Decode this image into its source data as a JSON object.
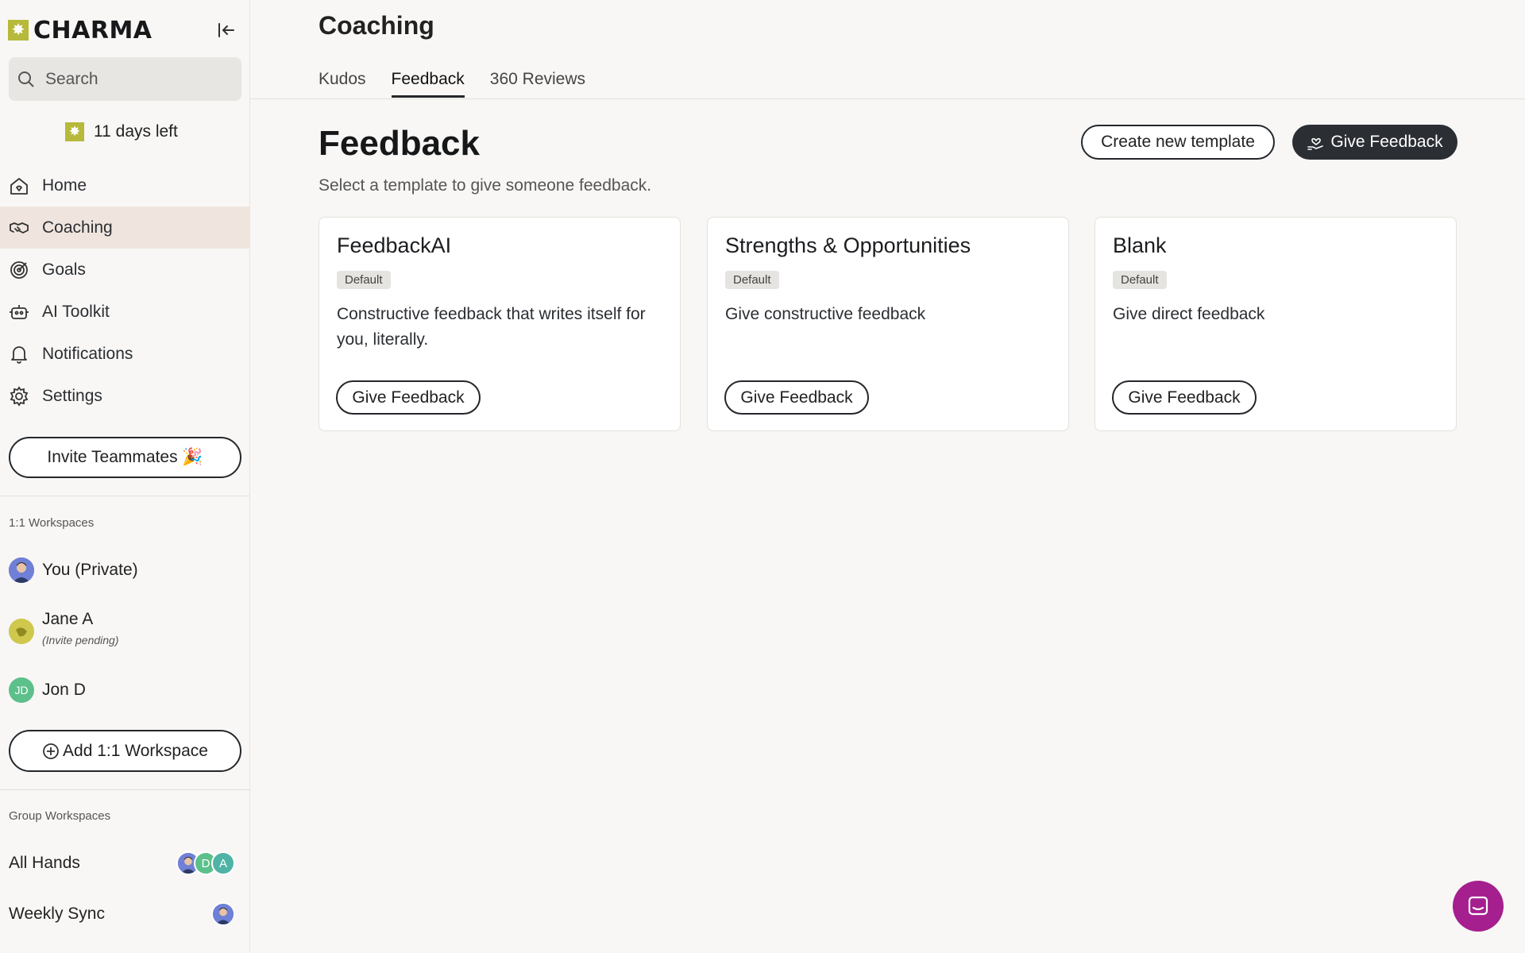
{
  "brand": {
    "name": "CHARMA",
    "logo_glyph": "✸"
  },
  "search": {
    "placeholder": "Search"
  },
  "trial": {
    "text": "11 days left",
    "glyph": "✸"
  },
  "nav": {
    "home": "Home",
    "coaching": "Coaching",
    "goals": "Goals",
    "ai_toolkit": "AI Toolkit",
    "notifications": "Notifications",
    "settings": "Settings"
  },
  "invite": {
    "label": "Invite Teammates 🎉"
  },
  "workspaces": {
    "label": "1:1 Workspaces",
    "you": "You (Private)",
    "jane": {
      "name": "Jane A",
      "status": "(Invite pending)"
    },
    "jon": {
      "name": "Jon D",
      "initials": "JD"
    },
    "add_label": "Add 1:1 Workspace"
  },
  "groups": {
    "label": "Group Workspaces",
    "all_hands": {
      "name": "All Hands",
      "initials": [
        "D",
        "A"
      ]
    },
    "weekly_sync": {
      "name": "Weekly Sync"
    }
  },
  "header": {
    "title": "Coaching",
    "tabs": [
      "Kudos",
      "Feedback",
      "360 Reviews"
    ]
  },
  "feedback": {
    "title": "Feedback",
    "subtitle": "Select a template to give someone feedback.",
    "create_template": "Create new template",
    "give_feedback": "Give Feedback",
    "cards": [
      {
        "title": "FeedbackAI",
        "badge": "Default",
        "desc": "Constructive feedback that writes itself for you, literally.",
        "button": "Give Feedback"
      },
      {
        "title": "Strengths & Opportunities",
        "badge": "Default",
        "desc": "Give constructive feedback",
        "button": "Give Feedback"
      },
      {
        "title": "Blank",
        "badge": "Default",
        "desc": "Give direct feedback",
        "button": "Give Feedback"
      }
    ]
  },
  "colors": {
    "accent": "#b7b93a",
    "active_nav": "#efe5de",
    "dark_button": "#2b2e33",
    "chat": "#a51f8f",
    "avatar_green": "#5cc08a",
    "avatar_teal": "#4fb3a6"
  }
}
